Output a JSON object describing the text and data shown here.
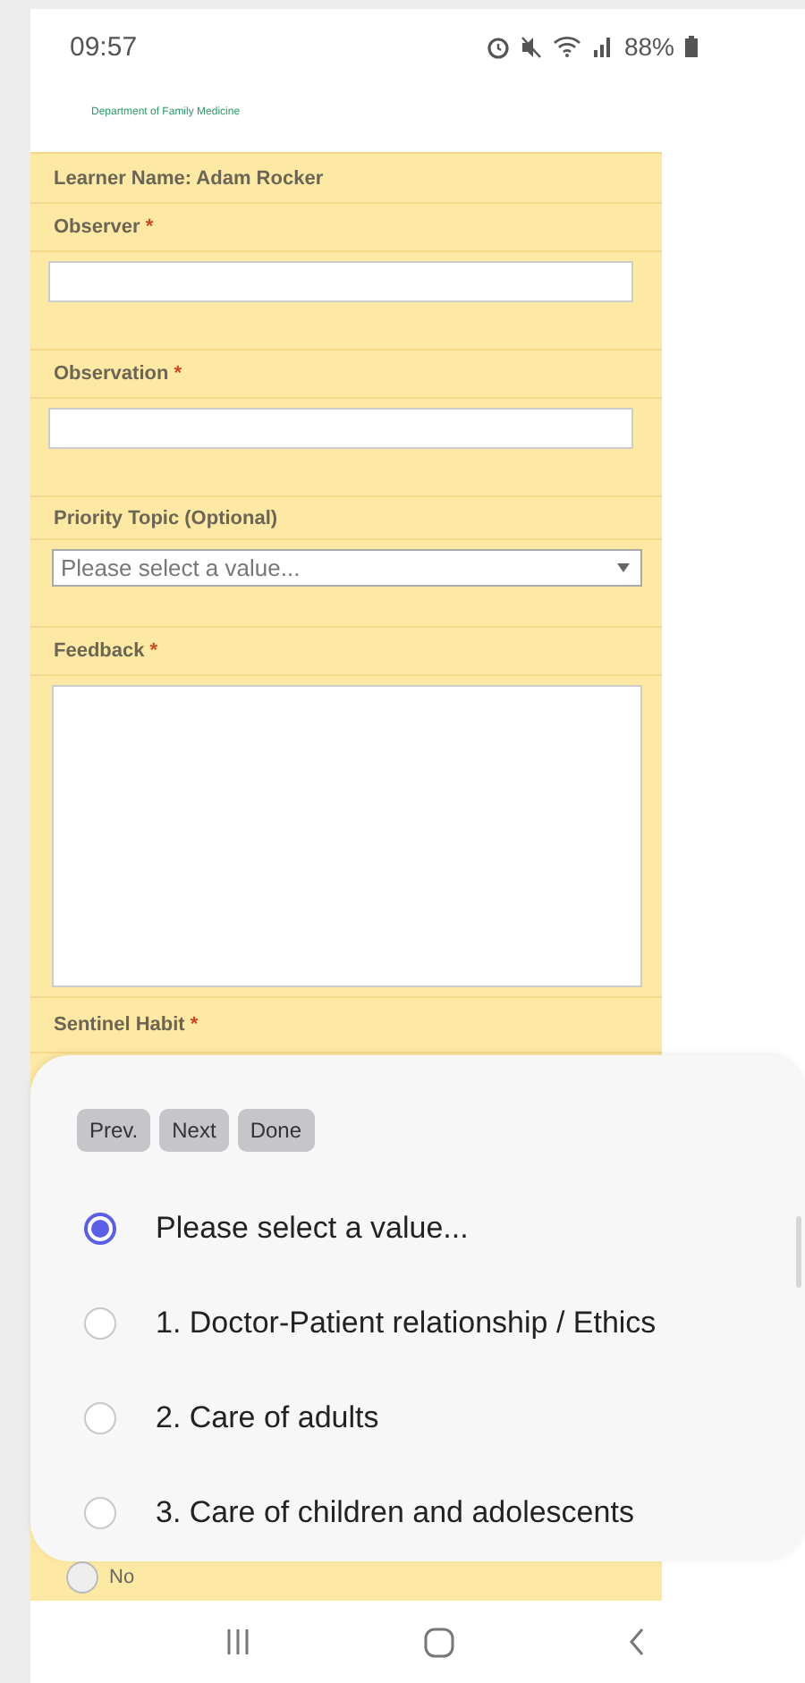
{
  "status_bar": {
    "time": "09:57",
    "battery": "88%"
  },
  "header": {
    "department": "Department of Family Medicine"
  },
  "learner": {
    "text": "Learner Name: Adam Rocker"
  },
  "fields": [
    {
      "kind": "text",
      "label": "Observer",
      "required_mark": "*"
    },
    {
      "kind": "text",
      "label": "Observation",
      "required_mark": "*"
    },
    {
      "kind": "select",
      "label": "Priority Topic (Optional)",
      "value": "Please select a value..."
    },
    {
      "kind": "textarea",
      "label": "Feedback",
      "required_mark": "*"
    },
    {
      "kind": "radio",
      "label": "Sentinel Habit",
      "required_mark": "*",
      "options": [
        {
          "label": "No",
          "selected": false
        }
      ]
    }
  ],
  "picker": {
    "buttons": [
      "Prev.",
      "Next",
      "Done"
    ],
    "options": [
      {
        "label": "Please select a value...",
        "selected": true
      },
      {
        "label": "1. Doctor-Patient relationship / Ethics",
        "selected": false
      },
      {
        "label": "2. Care of adults",
        "selected": false
      },
      {
        "label": "3. Care of children and adolescents",
        "selected": false
      }
    ]
  }
}
